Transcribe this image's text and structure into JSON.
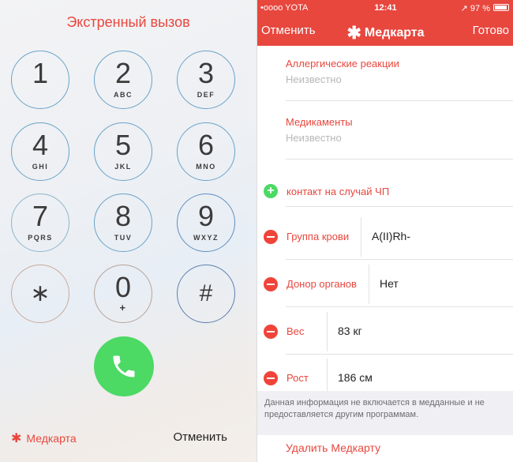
{
  "left": {
    "title": "Экстренный вызов",
    "keys": [
      {
        "digit": "1",
        "letters": ""
      },
      {
        "digit": "2",
        "letters": "ABC"
      },
      {
        "digit": "3",
        "letters": "DEF"
      },
      {
        "digit": "4",
        "letters": "GHI"
      },
      {
        "digit": "5",
        "letters": "JKL"
      },
      {
        "digit": "6",
        "letters": "MNO"
      },
      {
        "digit": "7",
        "letters": "PQRS"
      },
      {
        "digit": "8",
        "letters": "TUV"
      },
      {
        "digit": "9",
        "letters": "WXYZ"
      },
      {
        "digit": "∗",
        "letters": ""
      },
      {
        "digit": "0",
        "letters": "+"
      },
      {
        "digit": "#",
        "letters": ""
      }
    ],
    "medcard_star": "✱",
    "medcard_label": "Медкарта",
    "cancel_label": "Отменить",
    "call_icon": "phone-icon",
    "call_color": "#4cd964",
    "accent_color": "#e8473e"
  },
  "right": {
    "status": {
      "carrier": "•oooo YOTA",
      "time": "12:41",
      "right": "↗ 97 %"
    },
    "nav": {
      "cancel": "Отменить",
      "star": "✱",
      "title": "Медкарта",
      "done": "Готово"
    },
    "fields": {
      "allergies_label": "Аллергические реакции",
      "allergies_value": "Неизвестно",
      "medications_label": "Медикаменты",
      "medications_value": "Неизвестно"
    },
    "add_contact": "контакт на случай ЧП",
    "rows": [
      {
        "label": "Группа крови",
        "value": "A(II)Rh-"
      },
      {
        "label": "Донор органов",
        "value": "Нет"
      },
      {
        "label": "Вес",
        "value": "83 кг"
      },
      {
        "label": "Рост",
        "value": "186 см"
      }
    ],
    "footer_note": "Данная информация не включается в медданные и не предоставляется другим программам.",
    "delete_label": "Удалить Медкарту",
    "accent_color": "#e8473e",
    "remove_color": "#f0443a",
    "add_color": "#4cd964"
  }
}
